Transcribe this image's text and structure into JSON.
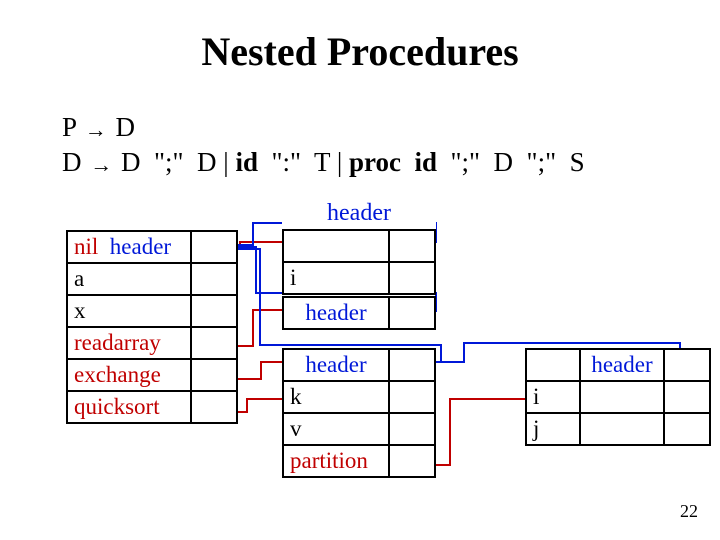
{
  "title": "Nested Procedures",
  "grammar": {
    "line1": {
      "P": "P",
      "D": "D"
    },
    "line2": {
      "D": "D",
      "D2": "D",
      "semi": "\";\"",
      "D3": "D",
      "bar": "|",
      "id": "id",
      "colon": "\":\"",
      "T": "T",
      "bar2": "|",
      "proc": "proc",
      "id2": "id",
      "semi2": "\";\"",
      "D4": "D",
      "semi3": "\";\"",
      "S": "S"
    }
  },
  "tables": {
    "main": {
      "header_prefix": "nil",
      "header_label": "header",
      "rows": [
        "a",
        "x",
        "readarray",
        "exchange",
        "quicksort"
      ]
    },
    "col2a": {
      "header": "header",
      "row": "i"
    },
    "col2b": {
      "header": "header"
    },
    "col2c": {
      "header": "header",
      "rows": [
        "k",
        "v",
        "partition"
      ]
    },
    "right": {
      "header": "header",
      "rows": [
        "i",
        "j"
      ]
    }
  },
  "pagenum": "22"
}
